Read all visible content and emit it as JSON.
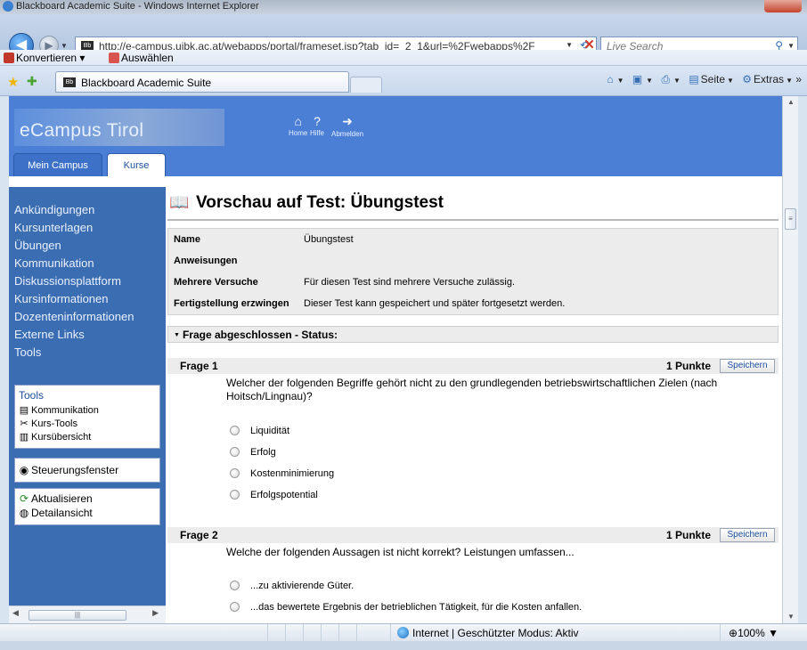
{
  "browser": {
    "window_title": "Blackboard Academic Suite - Windows Internet Explorer",
    "url": "http://e-campus.uibk.ac.at/webapps/portal/frameset.jsp?tab_id=_2_1&url=%2Fwebapps%2F",
    "search_placeholder": "Live Search",
    "menu": {
      "convert": "Konvertieren",
      "select": "Auswählen"
    },
    "tab_title": "Blackboard Academic Suite",
    "commands": {
      "page": "Seite",
      "tools": "Extras"
    },
    "status": {
      "zone": "Internet | Geschützter Modus: Aktiv",
      "zoom": "100%"
    }
  },
  "header": {
    "logo": "eCampus Tirol",
    "nav": [
      {
        "label": "Home",
        "icon": "home-icon"
      },
      {
        "label": "Hilfe",
        "icon": "help-icon"
      },
      {
        "label": "Abmelden",
        "icon": "logout-icon"
      }
    ],
    "tabs": {
      "campus": "Mein Campus",
      "courses": "Kurse"
    }
  },
  "sidebar": {
    "links": [
      "Ankündigungen",
      "Kursunterlagen",
      "Übungen",
      "Kommunikation",
      "Diskussionsplattform",
      "Kursinformationen",
      "Dozenteninformationen",
      "Externe Links",
      "Tools"
    ],
    "tools_box": {
      "title": "Tools",
      "items": [
        "Kommunikation",
        "Kurs-Tools",
        "Kursübersicht"
      ]
    },
    "control_panel": "Steuerungsfenster",
    "refresh": "Aktualisieren",
    "detail_view": "Detailansicht"
  },
  "main": {
    "title": "Vorschau auf Test: Übungstest",
    "info": [
      {
        "label": "Name",
        "value": "Übungstest"
      },
      {
        "label": "Anweisungen",
        "value": ""
      },
      {
        "label": "Mehrere Versuche",
        "value": "Für diesen Test sind mehrere Versuche zulässig."
      },
      {
        "label": "Fertigstellung erzwingen",
        "value": "Dieser Test kann gespeichert und später fortgesetzt werden."
      }
    ],
    "status_label": "Frage abgeschlossen",
    "status_suffix": "- Status:",
    "save_label": "Speichern",
    "questions": [
      {
        "title": "Frage 1",
        "points": "1 Punkte",
        "text": "Welcher der folgenden Begriffe gehört nicht zu den grundlegenden betriebswirtschaftlichen Zielen (nach Hoitsch/Lingnau)?",
        "options": [
          "Liquidität",
          "Erfolg",
          "Kostenminimierung",
          "Erfolgspotential"
        ]
      },
      {
        "title": "Frage 2",
        "points": "1 Punkte",
        "text": "Welche der folgenden Aussagen ist nicht korrekt? Leistungen umfassen...",
        "options": [
          "...zu aktivierende Güter.",
          "...das bewertete Ergebnis der betrieblichen Tätigkeit, für die Kosten anfallen."
        ]
      }
    ]
  }
}
